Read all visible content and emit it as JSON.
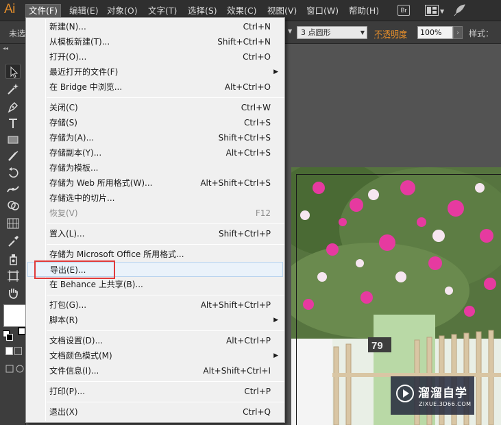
{
  "app": {
    "logo_text": "Ai",
    "accent_color": "#e58e2b"
  },
  "menubar": {
    "items": [
      {
        "label": "文件(F)",
        "active": true
      },
      {
        "label": "编辑(E)"
      },
      {
        "label": "对象(O)"
      },
      {
        "label": "文字(T)"
      },
      {
        "label": "选择(S)"
      },
      {
        "label": "效果(C)"
      },
      {
        "label": "视图(V)"
      },
      {
        "label": "窗口(W)"
      },
      {
        "label": "帮助(H)"
      }
    ],
    "bridge_label": "Br",
    "icons": [
      "bridge-icon",
      "arrange-documents-icon",
      "feather-icon"
    ]
  },
  "controlbar": {
    "label": "未选",
    "stroke_profile": "3 点圆形",
    "opacity_label": "不透明度",
    "opacity_value": "100%",
    "style_label": "样式："
  },
  "tools": {
    "icons": [
      "selection-tool-icon",
      "magic-wand-icon",
      "pen-tool-icon",
      "type-tool-icon",
      "rectangle-tool-icon",
      "paintbrush-icon",
      "rotate-tool-icon",
      "width-tool-icon",
      "shape-builder-icon",
      "perspective-grid-icon",
      "eyedropper-icon",
      "symbol-sprayer-icon",
      "artboard-tool-icon",
      "hand-tool-icon"
    ],
    "fill_color": "#ffffff"
  },
  "file_menu": {
    "items": [
      {
        "label": "新建(N)...",
        "shortcut": "Ctrl+N"
      },
      {
        "label": "从模板新建(T)...",
        "shortcut": "Shift+Ctrl+N"
      },
      {
        "label": "打开(O)...",
        "shortcut": "Ctrl+O"
      },
      {
        "label": "最近打开的文件(F)",
        "shortcut": "",
        "submenu": true
      },
      {
        "label": "在 Bridge 中浏览...",
        "shortcut": "Alt+Ctrl+O"
      },
      {
        "label": "关闭(C)",
        "shortcut": "Ctrl+W"
      },
      {
        "label": "存储(S)",
        "shortcut": "Ctrl+S"
      },
      {
        "label": "存储为(A)...",
        "shortcut": "Shift+Ctrl+S"
      },
      {
        "label": "存储副本(Y)...",
        "shortcut": "Alt+Ctrl+S"
      },
      {
        "label": "存储为模板...",
        "shortcut": ""
      },
      {
        "label": "存储为 Web 所用格式(W)...",
        "shortcut": "Alt+Shift+Ctrl+S"
      },
      {
        "label": "存储选中的切片...",
        "shortcut": ""
      },
      {
        "label": "恢复(V)",
        "shortcut": "F12",
        "disabled": true
      },
      {
        "label": "置入(L)...",
        "shortcut": "Shift+Ctrl+P"
      },
      {
        "label": "存储为 Microsoft Office 所用格式...",
        "shortcut": ""
      },
      {
        "label": "导出(E)...",
        "shortcut": "",
        "hovered": true
      },
      {
        "label": "在 Behance 上共享(B)...",
        "shortcut": ""
      },
      {
        "label": "打包(G)...",
        "shortcut": "Alt+Shift+Ctrl+P"
      },
      {
        "label": "脚本(R)",
        "shortcut": "",
        "submenu": true
      },
      {
        "label": "文档设置(D)...",
        "shortcut": "Alt+Ctrl+P"
      },
      {
        "label": "文档颜色模式(M)",
        "shortcut": "",
        "submenu": true
      },
      {
        "label": "文件信息(I)...",
        "shortcut": "Alt+Shift+Ctrl+I"
      },
      {
        "label": "打印(P)...",
        "shortcut": "Ctrl+P"
      },
      {
        "label": "退出(X)",
        "shortcut": "Ctrl+Q"
      }
    ],
    "highlight_color": "#e03a3a"
  },
  "canvas": {
    "photo_sign": "79"
  },
  "watermark": {
    "title": "溜溜自学",
    "subtitle": "ZIXUE.3D66.COM"
  }
}
